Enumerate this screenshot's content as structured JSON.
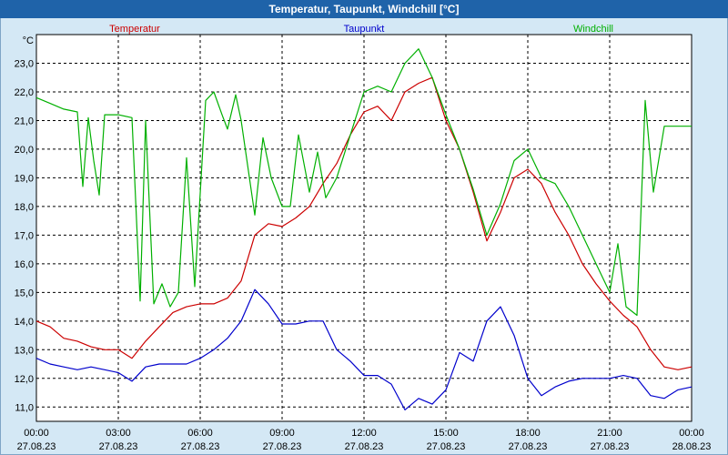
{
  "window": {
    "title": "Temperatur, Taupunkt, Windchill [°C]"
  },
  "chart_data": {
    "type": "line",
    "title": "Temperatur, Taupunkt, Windchill [°C]",
    "ylabel": "°C",
    "xlabel": "",
    "xlim": [
      0,
      24
    ],
    "ylim": [
      10.5,
      24.0
    ],
    "grid": true,
    "legend_placement": "top",
    "y_ticks": [
      "11,0",
      "12,0",
      "13,0",
      "14,0",
      "15,0",
      "16,0",
      "17,0",
      "18,0",
      "19,0",
      "20,0",
      "21,0",
      "22,0",
      "23,0"
    ],
    "x_ticks": [
      {
        "time": "00:00",
        "date": "27.08.23"
      },
      {
        "time": "03:00",
        "date": "27.08.23"
      },
      {
        "time": "06:00",
        "date": "27.08.23"
      },
      {
        "time": "09:00",
        "date": "27.08.23"
      },
      {
        "time": "12:00",
        "date": "27.08.23"
      },
      {
        "time": "15:00",
        "date": "27.08.23"
      },
      {
        "time": "18:00",
        "date": "27.08.23"
      },
      {
        "time": "21:00",
        "date": "27.08.23"
      },
      {
        "time": "00:00",
        "date": "28.08.23"
      }
    ],
    "series": [
      {
        "name": "Temperatur",
        "color": "#cc0000",
        "x": [
          0.0,
          0.5,
          1.0,
          1.5,
          2.0,
          2.5,
          3.0,
          3.5,
          4.0,
          4.5,
          5.0,
          5.5,
          6.0,
          6.5,
          7.0,
          7.5,
          8.0,
          8.5,
          9.0,
          9.5,
          10.0,
          10.5,
          11.0,
          11.5,
          12.0,
          12.5,
          13.0,
          13.5,
          14.0,
          14.5,
          15.0,
          15.5,
          16.0,
          16.5,
          17.0,
          17.5,
          18.0,
          18.5,
          19.0,
          19.5,
          20.0,
          20.5,
          21.0,
          21.5,
          22.0,
          22.5,
          23.0,
          23.5,
          24.0
        ],
        "y": [
          14.0,
          13.8,
          13.4,
          13.3,
          13.1,
          13.0,
          13.0,
          12.7,
          13.3,
          13.8,
          14.3,
          14.5,
          14.6,
          14.6,
          14.8,
          15.4,
          17.0,
          17.4,
          17.3,
          17.6,
          18.0,
          18.8,
          19.5,
          20.5,
          21.3,
          21.5,
          21.0,
          22.0,
          22.3,
          22.5,
          21.0,
          20.0,
          18.5,
          16.8,
          17.8,
          19.0,
          19.3,
          18.8,
          17.8,
          17.0,
          16.0,
          15.3,
          14.7,
          14.2,
          13.8,
          13.0,
          12.4,
          12.3,
          12.4
        ]
      },
      {
        "name": "Taupunkt",
        "color": "#0000cc",
        "x": [
          0.0,
          0.5,
          1.0,
          1.5,
          2.0,
          2.5,
          3.0,
          3.5,
          4.0,
          4.5,
          5.0,
          5.5,
          6.0,
          6.5,
          7.0,
          7.5,
          8.0,
          8.5,
          9.0,
          9.5,
          10.0,
          10.5,
          11.0,
          11.5,
          12.0,
          12.5,
          13.0,
          13.5,
          14.0,
          14.5,
          15.0,
          15.5,
          16.0,
          16.5,
          17.0,
          17.5,
          18.0,
          18.5,
          19.0,
          19.5,
          20.0,
          20.5,
          21.0,
          21.5,
          22.0,
          22.5,
          23.0,
          23.5,
          24.0
        ],
        "y": [
          12.7,
          12.5,
          12.4,
          12.3,
          12.4,
          12.3,
          12.2,
          11.9,
          12.4,
          12.5,
          12.5,
          12.5,
          12.7,
          13.0,
          13.4,
          14.0,
          15.1,
          14.6,
          13.9,
          13.9,
          14.0,
          14.0,
          13.0,
          12.6,
          12.1,
          12.1,
          11.8,
          10.9,
          11.3,
          11.1,
          11.6,
          12.9,
          12.6,
          14.0,
          14.5,
          13.5,
          12.0,
          11.4,
          11.7,
          11.9,
          12.0,
          12.0,
          12.0,
          12.1,
          12.0,
          11.4,
          11.3,
          11.6,
          11.7
        ]
      },
      {
        "name": "Windchill",
        "color": "#00b000",
        "x": [
          0.0,
          0.5,
          1.0,
          1.5,
          1.7,
          1.9,
          2.1,
          2.3,
          2.5,
          3.0,
          3.5,
          3.8,
          4.0,
          4.3,
          4.6,
          4.9,
          5.2,
          5.5,
          5.8,
          6.2,
          6.5,
          6.8,
          7.0,
          7.3,
          7.5,
          8.0,
          8.3,
          8.6,
          9.0,
          9.3,
          9.6,
          10.0,
          10.3,
          10.6,
          11.0,
          11.5,
          12.0,
          12.5,
          13.0,
          13.5,
          14.0,
          14.5,
          15.0,
          15.5,
          16.0,
          16.5,
          17.0,
          17.5,
          18.0,
          18.5,
          19.0,
          19.5,
          20.0,
          20.5,
          21.0,
          21.3,
          21.6,
          22.0,
          22.3,
          22.6,
          23.0,
          23.5,
          24.0
        ],
        "y": [
          21.8,
          21.6,
          21.4,
          21.3,
          18.7,
          21.1,
          19.6,
          18.4,
          21.2,
          21.2,
          21.1,
          14.7,
          21.0,
          14.6,
          15.3,
          14.5,
          15.0,
          19.7,
          15.2,
          21.7,
          22.0,
          21.2,
          20.7,
          21.9,
          21.0,
          17.7,
          20.4,
          19.0,
          18.0,
          18.0,
          20.5,
          18.5,
          19.9,
          18.3,
          19.0,
          20.5,
          22.0,
          22.2,
          22.0,
          23.0,
          23.5,
          22.5,
          21.2,
          20.0,
          18.6,
          17.0,
          18.1,
          19.6,
          20.0,
          19.0,
          18.8,
          18.0,
          17.0,
          16.0,
          15.0,
          16.7,
          14.5,
          14.2,
          21.7,
          18.5,
          20.8,
          20.8,
          20.8
        ]
      }
    ]
  }
}
